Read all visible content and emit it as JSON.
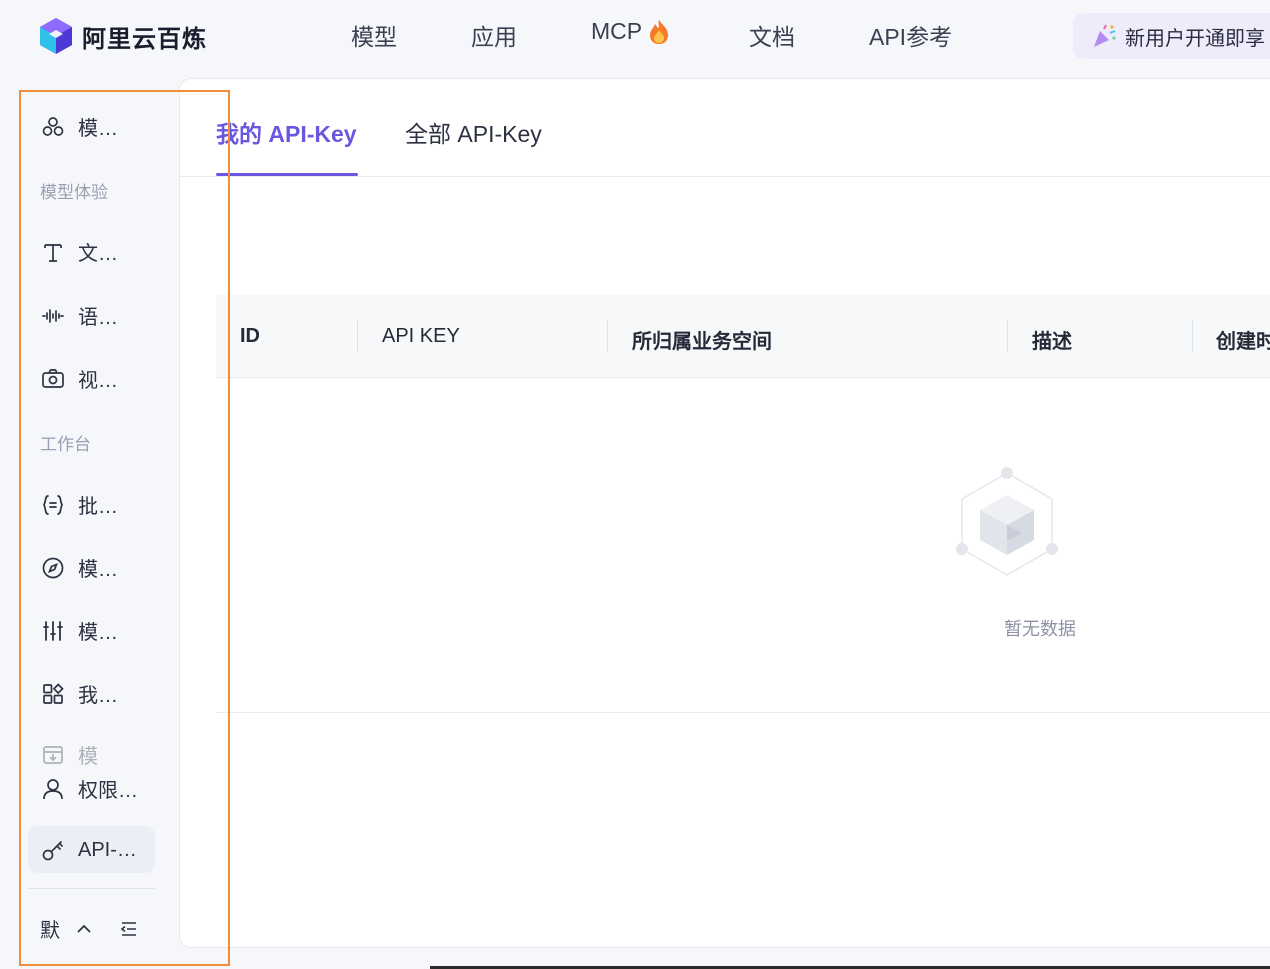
{
  "header": {
    "brand_name": "阿里云百炼",
    "nav": [
      "模型",
      "应用",
      "MCP",
      "文档",
      "API参考"
    ],
    "promo_text": "新用户开通即享"
  },
  "sidebar": {
    "items_top": [
      {
        "label": "模…",
        "icon": "model-hub-icon"
      }
    ],
    "group_experience": "模型体验",
    "items_experience": [
      {
        "label": "文…",
        "icon": "text-icon"
      },
      {
        "label": "语…",
        "icon": "audio-wave-icon"
      },
      {
        "label": "视…",
        "icon": "camera-icon"
      }
    ],
    "group_workbench": "工作台",
    "items_workbench": [
      {
        "label": "批…",
        "icon": "braces-icon"
      },
      {
        "label": "模…",
        "icon": "compass-icon"
      },
      {
        "label": "模…",
        "icon": "sliders-icon"
      },
      {
        "label": "我…",
        "icon": "apps-icon"
      },
      {
        "label": "模",
        "icon": "download-box-icon"
      }
    ],
    "permissions": {
      "label": "权限…",
      "icon": "user-icon"
    },
    "api_key": {
      "label": "API-…",
      "icon": "key-icon"
    },
    "footer": {
      "label": "默",
      "icon_expand": "chevron-up-icon",
      "icon_collapse": "collapse-menu-icon"
    }
  },
  "tabs": {
    "mine": "我的 API-Key",
    "all": "全部 API-Key"
  },
  "table": {
    "columns": [
      "ID",
      "API KEY",
      "所归属业务空间",
      "描述",
      "创建时"
    ],
    "empty_text": "暂无数据"
  },
  "colors": {
    "accent": "#6a57e0",
    "highlight_box": "#f08c3a"
  }
}
